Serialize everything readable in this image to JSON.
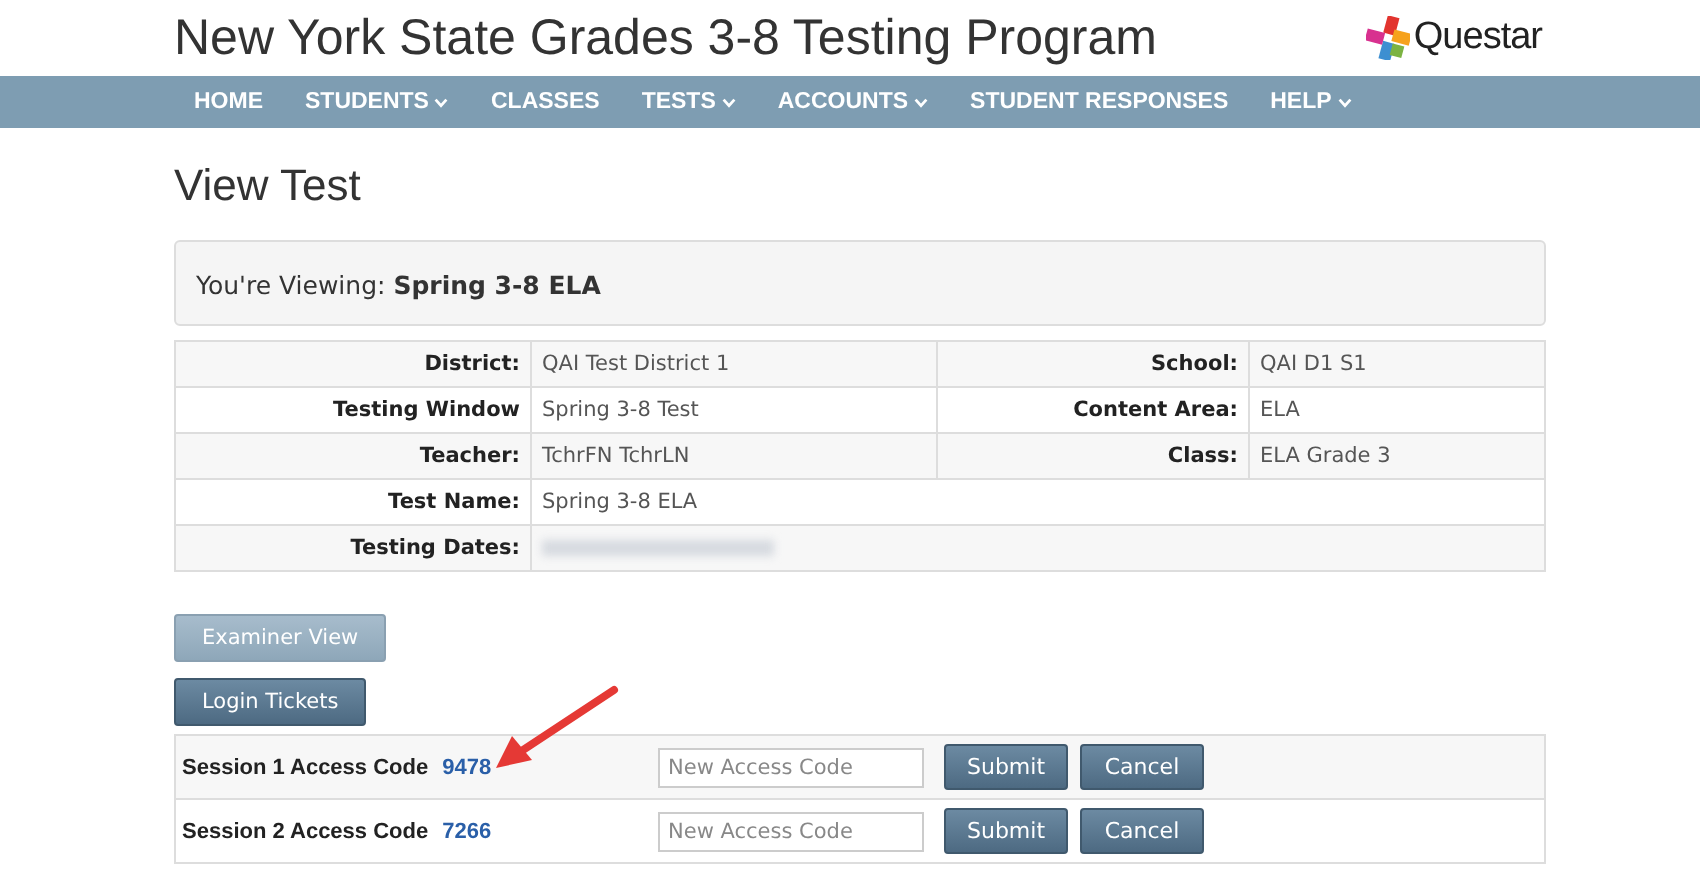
{
  "header": {
    "title": "New York State Grades 3-8 Testing Program",
    "logo_text": "Questar"
  },
  "nav": [
    {
      "label": "HOME",
      "dropdown": false
    },
    {
      "label": "STUDENTS",
      "dropdown": true
    },
    {
      "label": "CLASSES",
      "dropdown": false
    },
    {
      "label": "TESTS",
      "dropdown": true
    },
    {
      "label": "ACCOUNTS",
      "dropdown": true
    },
    {
      "label": "STUDENT RESPONSES",
      "dropdown": false
    },
    {
      "label": "HELP",
      "dropdown": true
    }
  ],
  "page_title": "View Test",
  "viewing": {
    "label": "You're Viewing:",
    "value": "Spring 3-8 ELA"
  },
  "details": [
    {
      "label": "District:",
      "value": "QAI Test District 1",
      "label_2": "School:",
      "value_2": "QAI D1 S1"
    },
    {
      "label": "Testing Window",
      "value": "Spring 3-8 Test",
      "label_2": "Content Area:",
      "value_2": "ELA"
    },
    {
      "label": "Teacher:",
      "value": "TchrFN TchrLN",
      "label_2": "Class:",
      "value_2": "ELA Grade 3"
    },
    {
      "label": "Test Name:",
      "value": "Spring 3-8 ELA"
    },
    {
      "label": "Testing Dates:",
      "redacted": true
    }
  ],
  "buttons": [
    {
      "label": "Examiner View",
      "disabled": true
    },
    {
      "label": "Login Tickets",
      "disabled": false
    }
  ],
  "sessions": [
    {
      "label": "Session 1 Access Code",
      "code": "9478",
      "placeholder": "New Access Code",
      "submit": "Submit",
      "cancel": "Cancel",
      "annotated": true
    },
    {
      "label": "Session 2 Access Code",
      "code": "7266",
      "placeholder": "New Access Code",
      "submit": "Submit",
      "cancel": "Cancel",
      "annotated": false
    }
  ]
}
